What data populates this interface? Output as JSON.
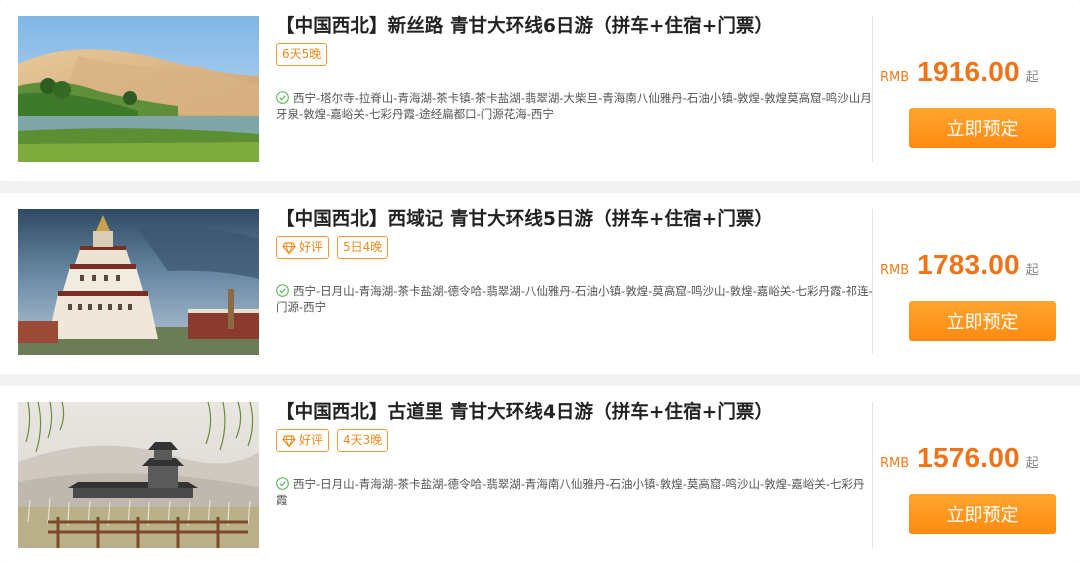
{
  "currency_label": "RMB",
  "price_suffix": "起",
  "book_label": "立即预定",
  "accent_color": "#f07318",
  "tours": [
    {
      "title": "【中国西北】新丝路 青甘大环线6日游（拼车+住宿+门票）",
      "tags": [
        "6天5晚"
      ],
      "route": "西宁-塔尔寺-拉脊山-青海湖-茶卡镇-茶卡盐湖-翡翠湖-大柴旦-青海南八仙雅丹-石油小镇-敦煌-敦煌莫高窟-鸣沙山月牙泉-敦煌-嘉峪关-七彩丹霞-途经扁都口-门源花海-西宁",
      "price": "1916.00",
      "image_icon": "desert-oasis-photo"
    },
    {
      "title": "【中国西北】西域记 青甘大环线5日游（拼车+住宿+门票）",
      "good_review": "好评",
      "tags": [
        "5日4晚"
      ],
      "route": "西宁-日月山-青海湖-茶卡盐湖-德令哈-翡翠湖-八仙雅丹-石油小镇-敦煌-莫高窟-鸣沙山-敦煌-嘉峪关-七彩丹霞-祁连-门源-西宁",
      "price": "1783.00",
      "image_icon": "monastery-photo"
    },
    {
      "title": "【中国西北】古道里 青甘大环线4日游（拼车+住宿+门票）",
      "good_review": "好评",
      "tags": [
        "4天3晚"
      ],
      "route": "西宁-日月山-青海湖-茶卡盐湖-德令哈-翡翠湖-青海南八仙雅丹-石油小镇-敦煌-莫高窟-鸣沙山-敦煌-嘉峪关-七彩丹霞",
      "price": "1576.00",
      "image_icon": "pavilion-dunes-photo"
    }
  ]
}
